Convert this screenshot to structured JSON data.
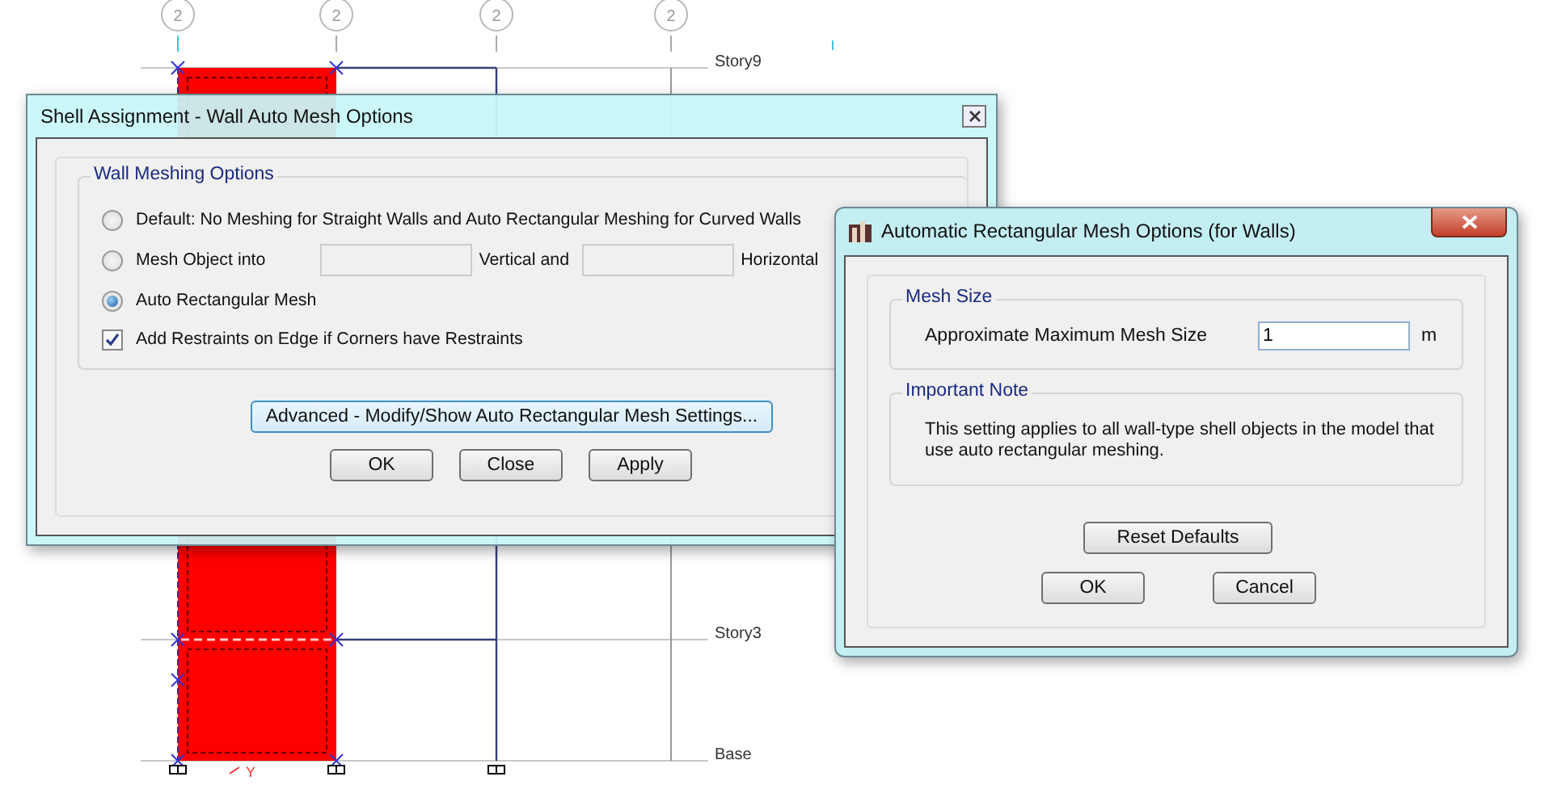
{
  "canvas": {
    "grid_bubbles": [
      "2",
      "2",
      "2",
      "2"
    ],
    "story_levels": [
      "Story9",
      "Story3",
      "Base"
    ],
    "axis_label": "Y"
  },
  "shell_dialog": {
    "title": "Shell Assignment - Wall Auto Mesh Options",
    "group_title": "Wall Meshing Options",
    "options": [
      {
        "kind": "radio",
        "label": "Default:  No Meshing for Straight Walls and Auto Rectangular Meshing for Curved Walls",
        "selected": false
      },
      {
        "kind": "radio_fields",
        "label": "Mesh Object into",
        "selected": false,
        "middle_label": "Vertical  and",
        "end_label": "Horizontal"
      },
      {
        "kind": "radio",
        "label": "Auto Rectangular Mesh",
        "selected": true
      },
      {
        "kind": "checkbox",
        "label": "Add Restraints on Edge if Corners have Restraints",
        "checked": true
      }
    ],
    "advanced_button": "Advanced - Modify/Show Auto Rectangular Mesh Settings...",
    "buttons": [
      "OK",
      "Close",
      "Apply"
    ]
  },
  "mesh_dialog": {
    "title": "Automatic Rectangular Mesh Options (for Walls)",
    "mesh_size": {
      "title": "Mesh Size",
      "label": "Approximate Maximum Mesh Size",
      "value": "1",
      "unit": "m"
    },
    "note": {
      "title": "Important Note",
      "text": "This setting applies to all wall-type shell objects in the model that use auto rectangular meshing."
    },
    "reset_button": "Reset Defaults",
    "buttons": [
      "OK",
      "Cancel"
    ]
  }
}
